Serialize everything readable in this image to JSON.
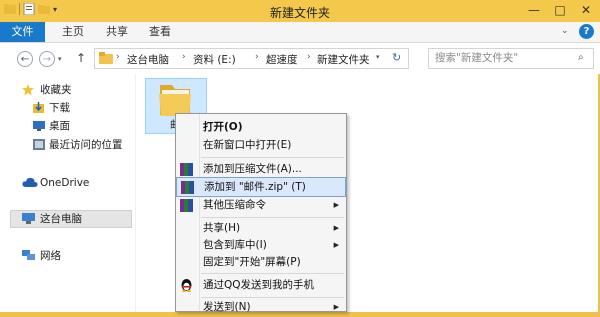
{
  "window": {
    "title": "新建文件夹"
  },
  "ribbon": {
    "tabs": [
      "文件",
      "主页",
      "共享",
      "查看"
    ]
  },
  "address": {
    "path": [
      "这台电脑",
      "资料 (E:)",
      "超速度",
      "新建文件夹"
    ]
  },
  "search": {
    "placeholder": "搜索\"新建文件夹\""
  },
  "nav": {
    "favorites": "收藏夹",
    "downloads": "下载",
    "desktop": "桌面",
    "recent": "最近访问的位置",
    "onedrive": "OneDrive",
    "thispc": "这台电脑",
    "network": "网络"
  },
  "folder": {
    "name": "邮"
  },
  "menu": {
    "open": "打开(O)",
    "open_new_window": "在新窗口中打开(E)",
    "add_archive": "添加到压缩文件(A)...",
    "add_zip": "添加到 \"邮件.zip\" (T)",
    "other_compress": "其他压缩命令",
    "share": "共享(H)",
    "include_library": "包含到库中(I)",
    "pin_start": "固定到\"开始\"屏幕(P)",
    "qq_send": "通过QQ发送到我的手机",
    "send_to": "发送到(N)"
  },
  "colors": {
    "accent": "#1979ca",
    "titlebar": "#f4c84b",
    "folder": "#f2c34f"
  }
}
